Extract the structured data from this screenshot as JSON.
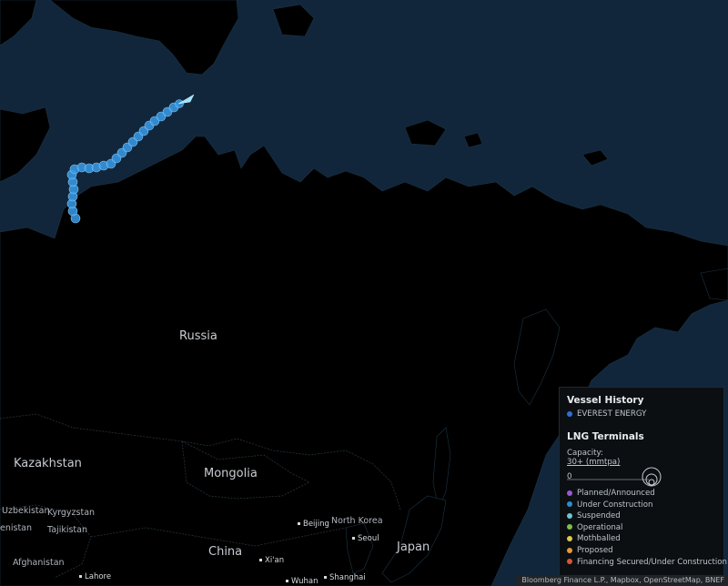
{
  "labels": {
    "russia": "Russia",
    "kazakhstan": "Kazakhstan",
    "mongolia": "Mongolia",
    "china": "China",
    "japan": "Japan",
    "uzbekistan": "Uzbekistan",
    "kyrgyzstan": "Kyrgyzstan",
    "tajikistan": "Tajikistan",
    "afghanistan": "Afghanistan",
    "turkmenistan": "enistan",
    "north_korea": "North Korea"
  },
  "cities": {
    "beijing": "Beijing",
    "seoul": "Seoul",
    "xian": "Xi'an",
    "wuhan": "Wuhan",
    "shanghai": "Shanghai",
    "lahore": "Lahore"
  },
  "legend": {
    "vessel_title": "Vessel History",
    "vessel_name": "EVEREST ENERGY",
    "vessel_color": "#2f6fd6",
    "lng_title": "LNG Terminals",
    "capacity_label": "Capacity:",
    "capacity_max": "30+ (mmtpa)",
    "capacity_min": "0",
    "statuses": [
      {
        "label": "Planned/Announced",
        "color": "#9b59d0"
      },
      {
        "label": "Under Construction",
        "color": "#2a8fd0"
      },
      {
        "label": "Suspended",
        "color": "#6fc3d6"
      },
      {
        "label": "Operational",
        "color": "#7cc04a"
      },
      {
        "label": "Mothballed",
        "color": "#e0c94a"
      },
      {
        "label": "Proposed",
        "color": "#e69a3a"
      },
      {
        "label": "Financing Secured/Under Construction",
        "color": "#d9543a"
      }
    ]
  },
  "attribution": "Bloomberg Finance L.P., Mapbox, OpenStreetMap, BNEF",
  "colors": {
    "ocean": "#11263a",
    "land": "#000000",
    "track": "#3a9be6"
  }
}
